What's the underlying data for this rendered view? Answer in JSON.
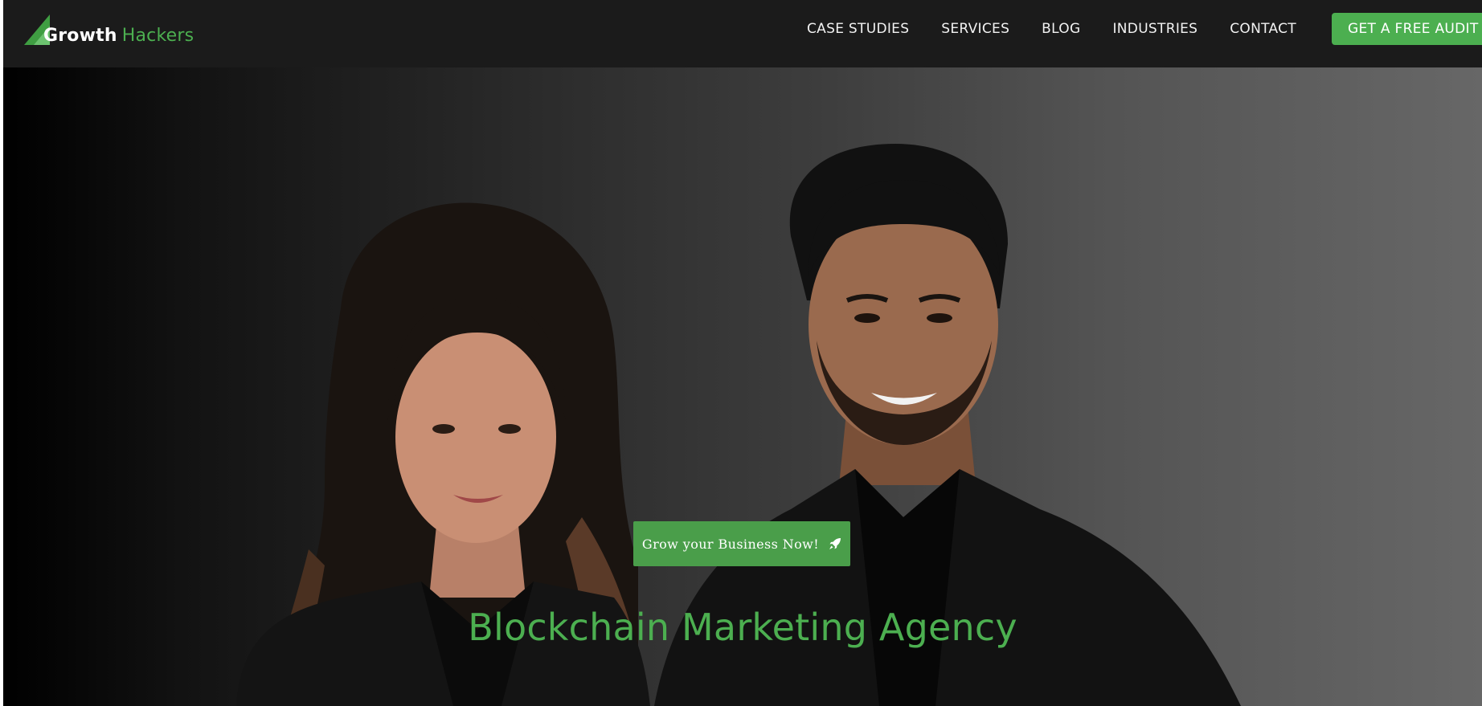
{
  "brand": {
    "word1": "Growth",
    "word2": "Hackers",
    "accent_color": "#4caf50"
  },
  "nav": {
    "items": [
      {
        "label": "CASE STUDIES"
      },
      {
        "label": "SERVICES"
      },
      {
        "label": "BLOG"
      },
      {
        "label": "INDUSTRIES"
      },
      {
        "label": "CONTACT"
      }
    ],
    "cta_label": "GET A FREE AUDIT"
  },
  "hero": {
    "button_label": "Grow your Business Now!",
    "button_icon": "rocket-icon",
    "title": "Blockchain Marketing Agency"
  }
}
